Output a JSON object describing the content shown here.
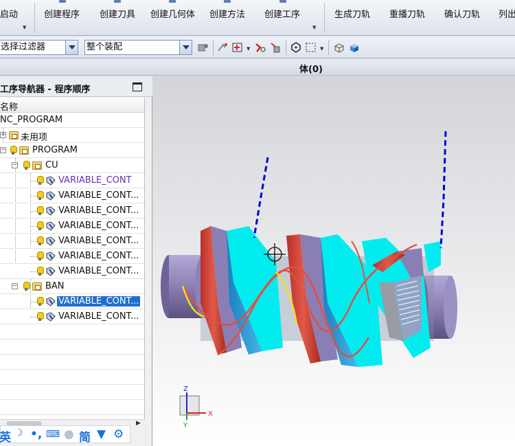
{
  "ribbon": {
    "start_label": "启动",
    "items": [
      "创建程序",
      "创建刀具",
      "创建几何体",
      "创建方法",
      "创建工序",
      "生成刀轨",
      "重播刀轨",
      "确认刀轨",
      "列出"
    ]
  },
  "toolbar": {
    "filter_value": "选择过滤器",
    "assembly_value": "整个装配"
  },
  "status": {
    "text": "体(0)"
  },
  "navigator": {
    "title": "工序导航器 - 程序顺序",
    "column_name": "名称",
    "tree": [
      {
        "label": "NC_PROGRAM"
      },
      {
        "label": "未用项"
      },
      {
        "label": "PROGRAM"
      },
      {
        "label": "CU"
      },
      {
        "label": "VARIABLE_CONT"
      },
      {
        "label": "VARIABLE_CONT..."
      },
      {
        "label": "VARIABLE_CONT..."
      },
      {
        "label": "VARIABLE_CONT..."
      },
      {
        "label": "VARIABLE_CONT..."
      },
      {
        "label": "VARIABLE_CONT..."
      },
      {
        "label": "VARIABLE_CONT..."
      },
      {
        "label": "BAN"
      },
      {
        "label": "VARIABLE_CONT..."
      },
      {
        "label": "VARIABLE_CONT..."
      }
    ]
  },
  "ime": {
    "lang": "英",
    "mode": "简"
  },
  "triad": {
    "x": "X",
    "y": "Y",
    "z": "Z"
  },
  "colors": {
    "selection": "#1e6fd0",
    "cyan_surface": "#00f0f0",
    "red_surface": "#d84a3a",
    "purple_body": "#8f84b8",
    "toolpath_blue": "#0000dd",
    "toolpath_yellow": "#f0e020"
  }
}
